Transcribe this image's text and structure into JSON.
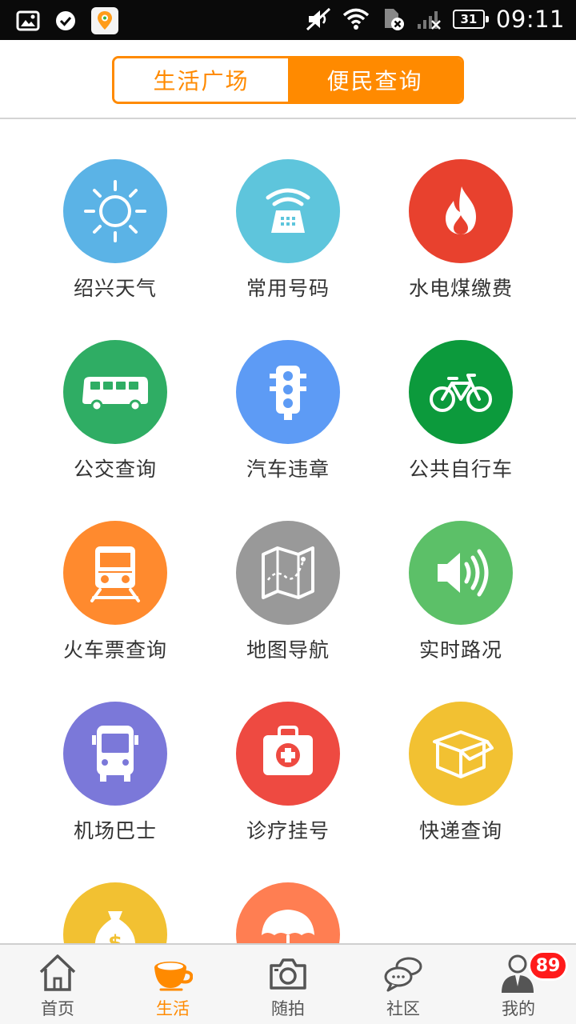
{
  "status_bar": {
    "time": "09:11",
    "battery": "31",
    "icons": [
      "gallery-icon",
      "check-icon",
      "maps-icon",
      "mute-icon",
      "wifi-icon",
      "sim-error-icon",
      "signal-icon",
      "battery-icon"
    ]
  },
  "header": {
    "tabs": [
      {
        "label": "生活广场",
        "active": false
      },
      {
        "label": "便民查询",
        "active": true
      }
    ]
  },
  "services": [
    {
      "label": "绍兴天气",
      "icon": "sun-icon",
      "color": "#5bb3e6"
    },
    {
      "label": "常用号码",
      "icon": "telephone-icon",
      "color": "#5ec5dc"
    },
    {
      "label": "水电煤缴费",
      "icon": "flame-icon",
      "color": "#e8412e"
    },
    {
      "label": "公交查询",
      "icon": "bus-icon",
      "color": "#2fad64"
    },
    {
      "label": "汽车违章",
      "icon": "traffic-light-icon",
      "color": "#5d9bf5"
    },
    {
      "label": "公共自行车",
      "icon": "bicycle-icon",
      "color": "#0c9a3c"
    },
    {
      "label": "火车票查询",
      "icon": "train-icon",
      "color": "#ff8a2e"
    },
    {
      "label": "地图导航",
      "icon": "map-icon",
      "color": "#999999"
    },
    {
      "label": "实时路况",
      "icon": "speaker-icon",
      "color": "#5cc068"
    },
    {
      "label": "机场巴士",
      "icon": "airport-bus-icon",
      "color": "#7b78d9"
    },
    {
      "label": "诊疗挂号",
      "icon": "medical-kit-icon",
      "color": "#ee4a41"
    },
    {
      "label": "快递查询",
      "icon": "package-icon",
      "color": "#f2c132"
    },
    {
      "label": "",
      "icon": "money-bag-icon",
      "color": "#f2c132"
    },
    {
      "label": "",
      "icon": "umbrella-icon",
      "color": "#ff7e52"
    }
  ],
  "bottom_nav": [
    {
      "label": "首页",
      "icon": "home-icon",
      "active": false
    },
    {
      "label": "生活",
      "icon": "coffee-cup-icon",
      "active": true
    },
    {
      "label": "随拍",
      "icon": "camera-icon",
      "active": false
    },
    {
      "label": "社区",
      "icon": "chat-bubbles-icon",
      "active": false
    },
    {
      "label": "我的",
      "icon": "user-icon",
      "active": false
    }
  ],
  "badge_count": "89",
  "colors": {
    "accent": "#ff8a00"
  }
}
